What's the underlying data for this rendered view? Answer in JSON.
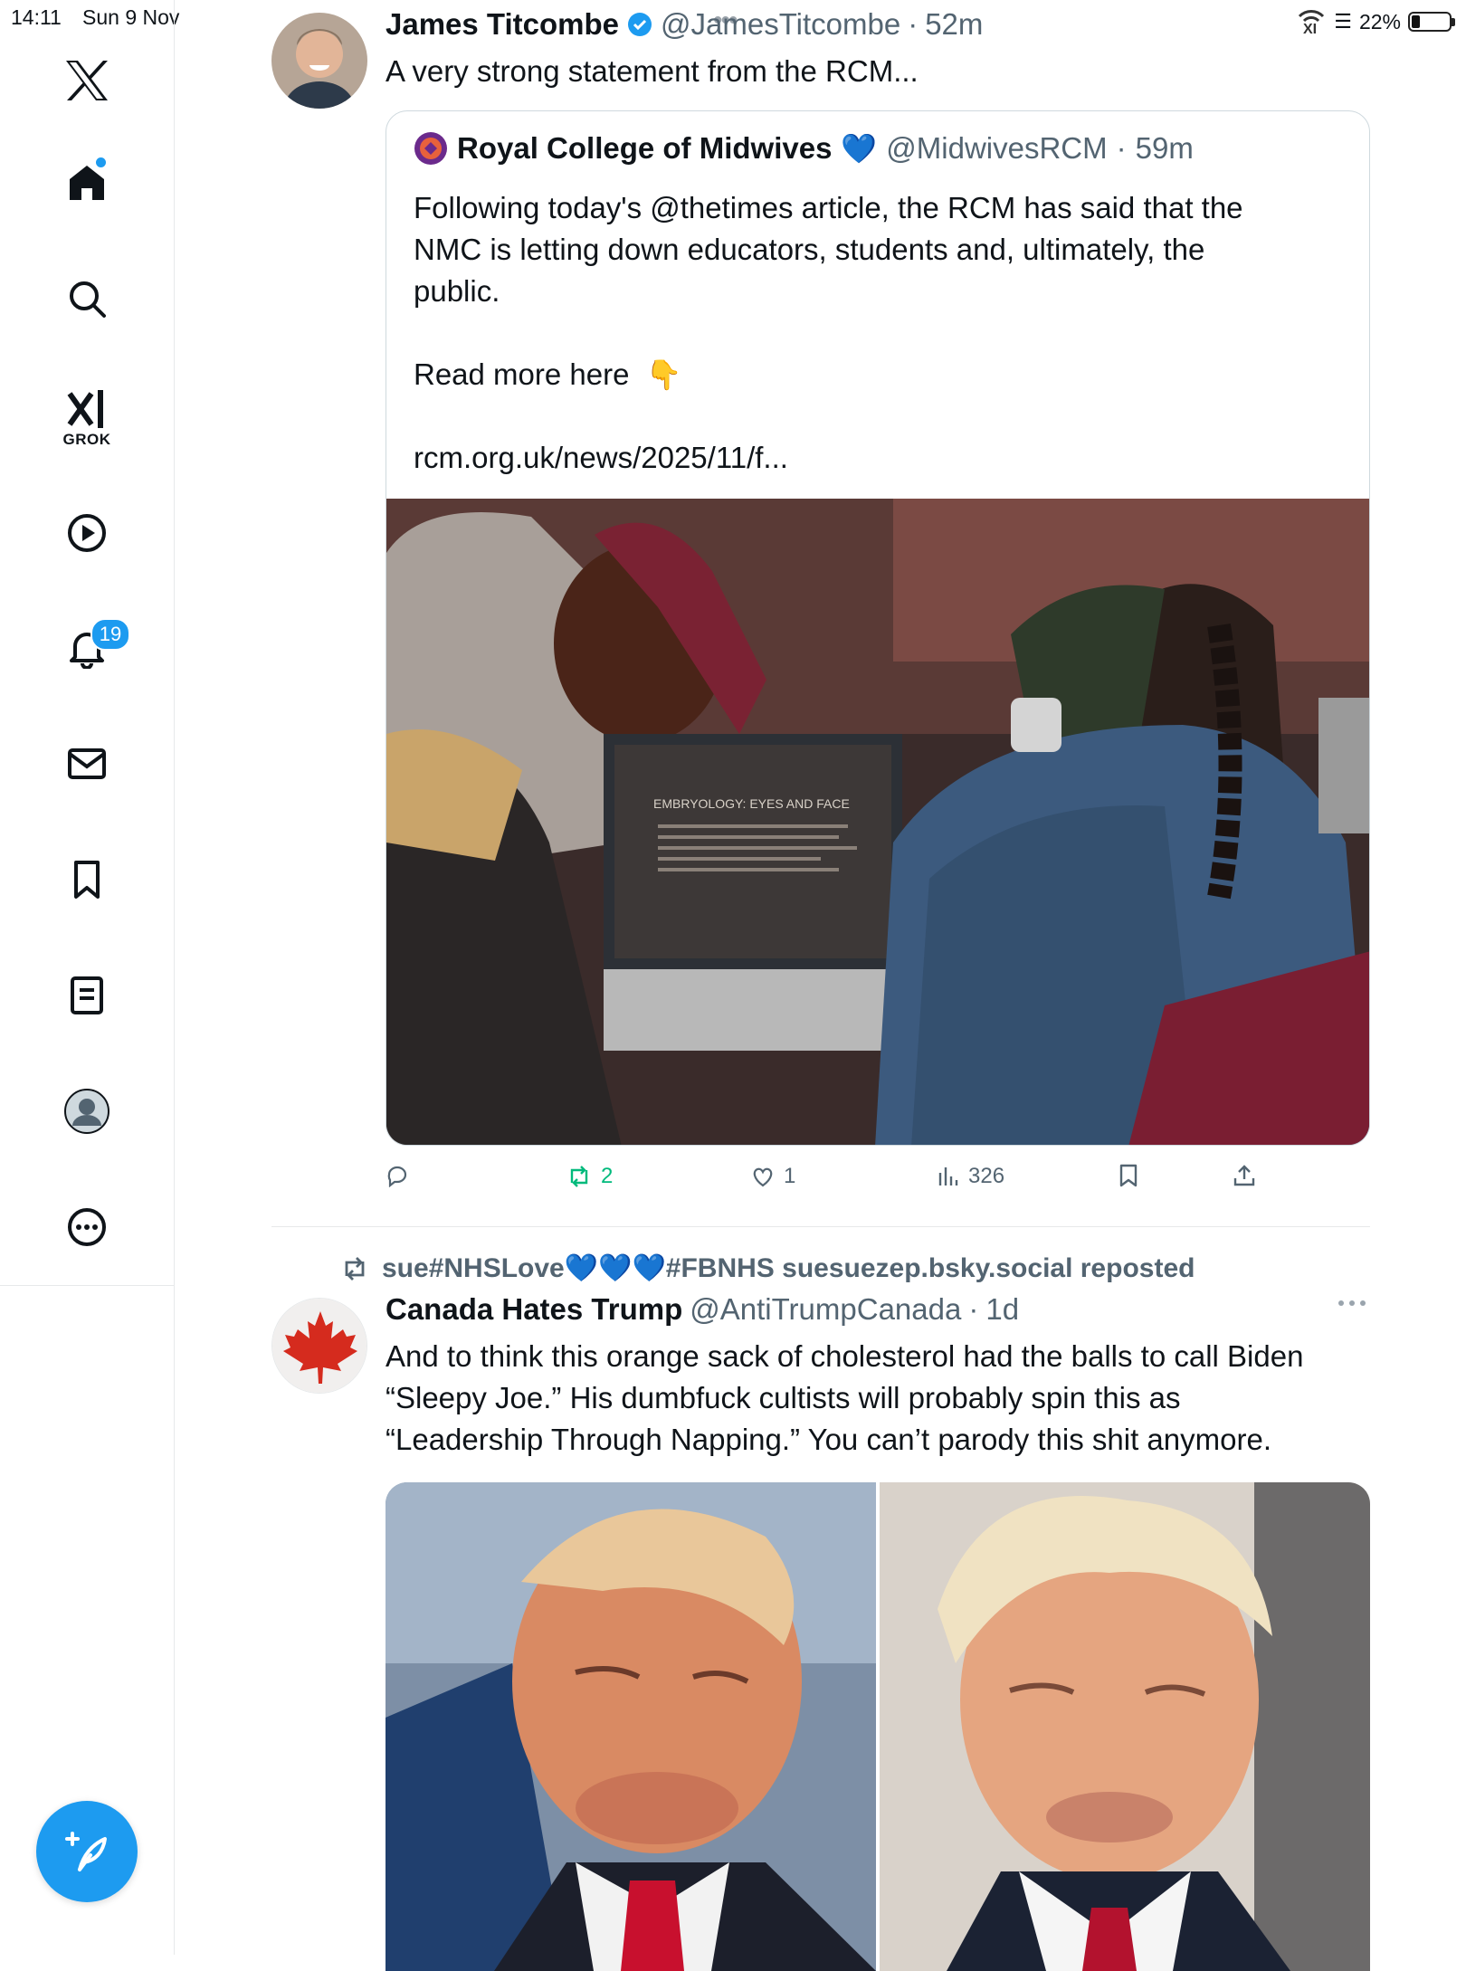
{
  "status_bar": {
    "time": "14:11",
    "date": "Sun 9 Nov",
    "battery": "22%",
    "battery_level": 0.22
  },
  "sidebar": {
    "grok_label": "GROK",
    "notifications_count": "19"
  },
  "tweet1": {
    "name": "James Titcombe",
    "handle": "@JamesTitcombe",
    "time": "52m",
    "text": "A very strong statement from the RCM...",
    "quote": {
      "name": "Royal College of Midwives",
      "handle": "@MidwivesRCM",
      "time": "59m",
      "text_line1": "Following today's @thetimes article, the RCM has said that the",
      "text_line2": "NMC is letting down educators, students and, ultimately, the",
      "text_line3": "public.",
      "read_more": "Read more here",
      "link": "rcm.org.uk/news/2025/11/f...",
      "image_screen_title": "EMBRYOLOGY: EYES AND FACE"
    },
    "actions": {
      "replies": "",
      "reposts": "2",
      "likes": "1",
      "views": "326"
    }
  },
  "tweet2": {
    "repost_label": "sue#NHSLove💙💙💙#FBNHS suesuezep.bsky.social reposted",
    "name": "Canada Hates Trump",
    "handle": "@AntiTrumpCanada",
    "time": "1d",
    "text_line1": "And to think this orange sack of cholesterol had the balls to call Biden",
    "text_line2": "“Sleepy Joe.” His dumbfuck cultists will probably spin this as",
    "text_line3": "“Leadership Through Napping.” You can’t parody this shit anymore."
  },
  "colors": {
    "accent": "#1d9bf0",
    "repost_green": "#00ba7c",
    "muted": "#536471"
  }
}
